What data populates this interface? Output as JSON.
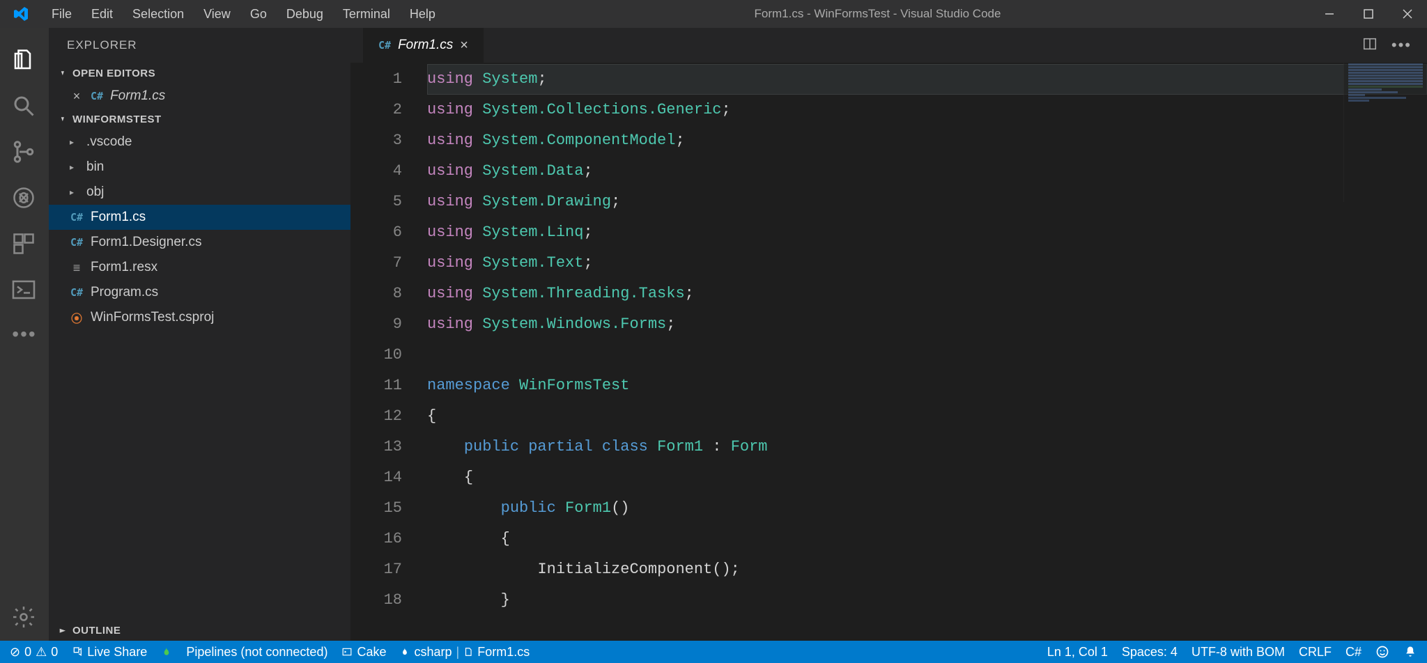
{
  "title": "Form1.cs - WinFormsTest - Visual Studio Code",
  "menus": [
    "File",
    "Edit",
    "Selection",
    "View",
    "Go",
    "Debug",
    "Terminal",
    "Help"
  ],
  "explorer": {
    "title": "EXPLORER",
    "openEditors": {
      "label": "OPEN EDITORS"
    },
    "openEditorItems": [
      {
        "name": "Form1.cs",
        "iconText": "C#",
        "italic": true
      }
    ],
    "projectLabel": "WINFORMSTEST",
    "tree": [
      {
        "type": "folder",
        "name": ".vscode"
      },
      {
        "type": "folder",
        "name": "bin"
      },
      {
        "type": "folder",
        "name": "obj"
      },
      {
        "type": "file",
        "name": "Form1.cs",
        "icon": "csharp",
        "selected": true
      },
      {
        "type": "file",
        "name": "Form1.Designer.cs",
        "icon": "csharp"
      },
      {
        "type": "file",
        "name": "Form1.resx",
        "icon": "resx"
      },
      {
        "type": "file",
        "name": "Program.cs",
        "icon": "csharp"
      },
      {
        "type": "file",
        "name": "WinFormsTest.csproj",
        "icon": "xml"
      }
    ],
    "outlineLabel": "OUTLINE"
  },
  "tab": {
    "label": "Form1.cs",
    "iconText": "C#"
  },
  "code_lines": [
    [
      [
        "tk-key",
        "using"
      ],
      [
        "tk-plain",
        " "
      ],
      [
        "tk-type",
        "System"
      ],
      [
        "tk-punc",
        ";"
      ]
    ],
    [
      [
        "tk-key",
        "using"
      ],
      [
        "tk-plain",
        " "
      ],
      [
        "tk-type",
        "System.Collections.Generic"
      ],
      [
        "tk-punc",
        ";"
      ]
    ],
    [
      [
        "tk-key",
        "using"
      ],
      [
        "tk-plain",
        " "
      ],
      [
        "tk-type",
        "System.ComponentModel"
      ],
      [
        "tk-punc",
        ";"
      ]
    ],
    [
      [
        "tk-key",
        "using"
      ],
      [
        "tk-plain",
        " "
      ],
      [
        "tk-type",
        "System.Data"
      ],
      [
        "tk-punc",
        ";"
      ]
    ],
    [
      [
        "tk-key",
        "using"
      ],
      [
        "tk-plain",
        " "
      ],
      [
        "tk-type",
        "System.Drawing"
      ],
      [
        "tk-punc",
        ";"
      ]
    ],
    [
      [
        "tk-key",
        "using"
      ],
      [
        "tk-plain",
        " "
      ],
      [
        "tk-type",
        "System.Linq"
      ],
      [
        "tk-punc",
        ";"
      ]
    ],
    [
      [
        "tk-key",
        "using"
      ],
      [
        "tk-plain",
        " "
      ],
      [
        "tk-type",
        "System.Text"
      ],
      [
        "tk-punc",
        ";"
      ]
    ],
    [
      [
        "tk-key",
        "using"
      ],
      [
        "tk-plain",
        " "
      ],
      [
        "tk-type",
        "System.Threading.Tasks"
      ],
      [
        "tk-punc",
        ";"
      ]
    ],
    [
      [
        "tk-key",
        "using"
      ],
      [
        "tk-plain",
        " "
      ],
      [
        "tk-type",
        "System.Windows.Forms"
      ],
      [
        "tk-punc",
        ";"
      ]
    ],
    [],
    [
      [
        "tk-kw",
        "namespace"
      ],
      [
        "tk-plain",
        " "
      ],
      [
        "tk-type",
        "WinFormsTest"
      ]
    ],
    [
      [
        "tk-punc",
        "{"
      ]
    ],
    [
      [
        "tk-plain",
        "    "
      ],
      [
        "tk-kw",
        "public"
      ],
      [
        "tk-plain",
        " "
      ],
      [
        "tk-kw",
        "partial"
      ],
      [
        "tk-plain",
        " "
      ],
      [
        "tk-kw",
        "class"
      ],
      [
        "tk-plain",
        " "
      ],
      [
        "tk-type",
        "Form1"
      ],
      [
        "tk-plain",
        " "
      ],
      [
        "tk-punc",
        ":"
      ],
      [
        "tk-plain",
        " "
      ],
      [
        "tk-type",
        "Form"
      ]
    ],
    [
      [
        "tk-plain",
        "    "
      ],
      [
        "tk-punc",
        "{"
      ]
    ],
    [
      [
        "tk-plain",
        "        "
      ],
      [
        "tk-kw",
        "public"
      ],
      [
        "tk-plain",
        " "
      ],
      [
        "tk-type",
        "Form1"
      ],
      [
        "tk-punc",
        "()"
      ]
    ],
    [
      [
        "tk-plain",
        "        "
      ],
      [
        "tk-punc",
        "{"
      ]
    ],
    [
      [
        "tk-plain",
        "            "
      ],
      [
        "tk-plain",
        "InitializeComponent"
      ],
      [
        "tk-punc",
        "();"
      ]
    ],
    [
      [
        "tk-plain",
        "        "
      ],
      [
        "tk-punc",
        "}"
      ]
    ]
  ],
  "status": {
    "errorsIcon": "⊘",
    "errors": "0",
    "warnIcon": "⚠",
    "warnings": "0",
    "liveShare": "Live Share",
    "pipelines": "Pipelines (not connected)",
    "cake": "Cake",
    "csharp": "csharp",
    "currentFile": "Form1.cs",
    "lnCol": "Ln 1, Col 1",
    "spaces": "Spaces: 4",
    "encoding": "UTF-8 with BOM",
    "eol": "CRLF",
    "lang": "C#"
  }
}
